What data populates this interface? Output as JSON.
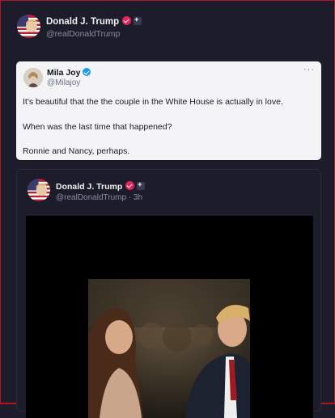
{
  "header": {
    "name": "Donald J. Trump",
    "handle": "@realDonaldTrump"
  },
  "quote": {
    "name": "Mila Joy",
    "handle": "@Milajoy",
    "more": "···",
    "lines": [
      "It's beautiful that the the couple in the White House is actually in love.",
      "When was the last time that happened?",
      "Ronnie and Nancy, perhaps."
    ]
  },
  "post": {
    "name": "Donald J. Trump",
    "handle": "@realDonaldTrump · 3h"
  },
  "colors": {
    "background": "#1d1c2a",
    "frame_border": "#b3121e",
    "verified_red": "#e0245e",
    "verified_blue": "#1d9bf0",
    "quote_card": "#f4f4f7"
  }
}
